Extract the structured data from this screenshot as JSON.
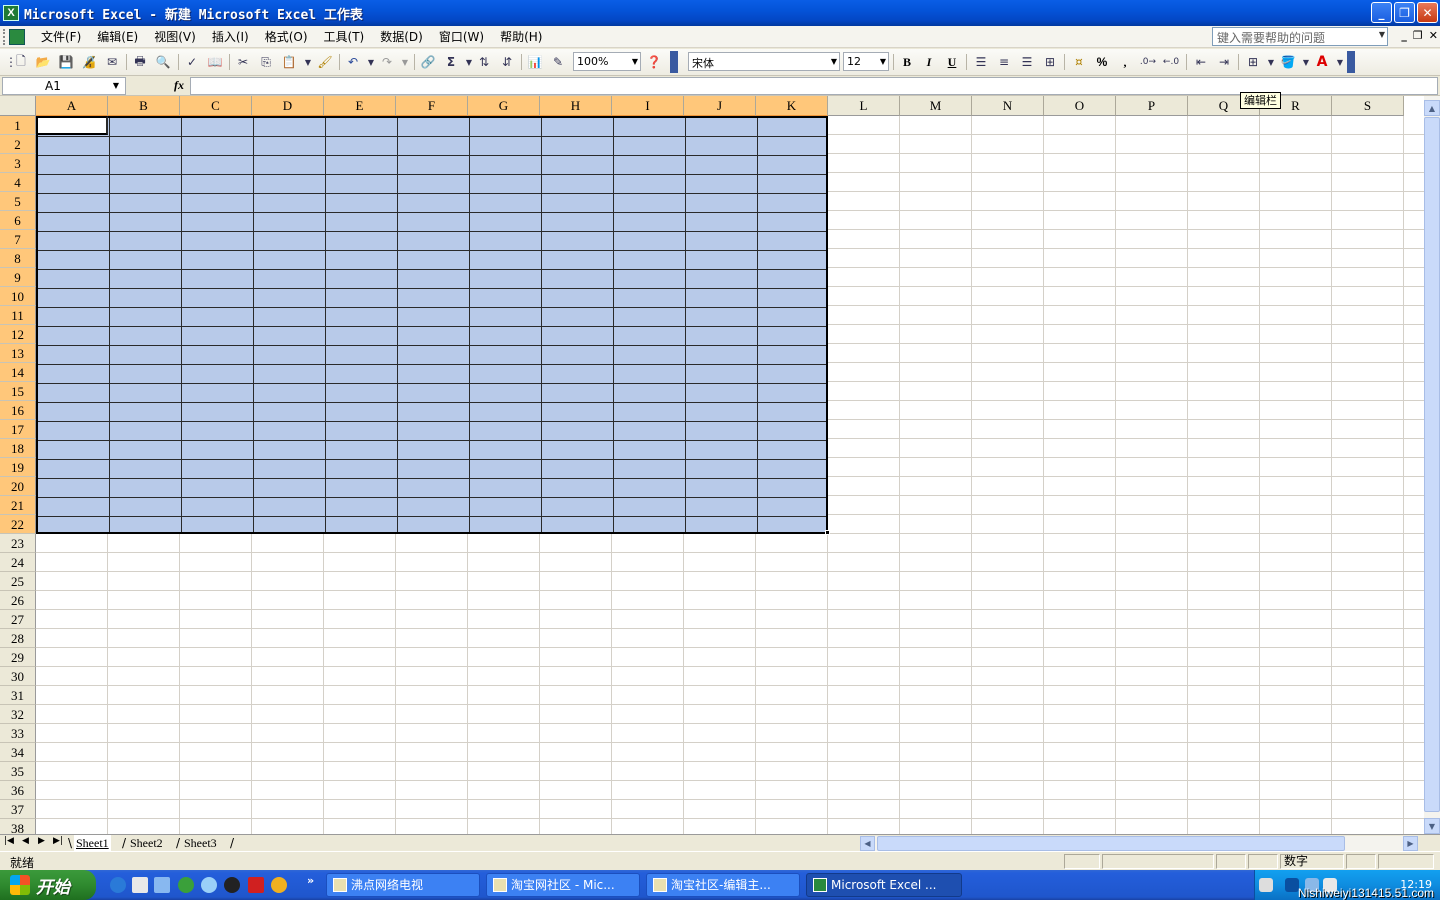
{
  "window": {
    "title": "Microsoft Excel - 新建 Microsoft Excel 工作表",
    "app_icon": "excel-icon"
  },
  "menu": {
    "items": [
      "文件(F)",
      "编辑(E)",
      "视图(V)",
      "插入(I)",
      "格式(O)",
      "工具(T)",
      "数据(D)",
      "窗口(W)",
      "帮助(H)"
    ],
    "help_placeholder": "键入需要帮助的问题"
  },
  "toolbar": {
    "zoom": "100%",
    "font_name": "宋体",
    "font_size": "12",
    "bold": "B",
    "italic": "I",
    "underline": "U",
    "percent": "%",
    "comma": ","
  },
  "formula_bar": {
    "name_box": "A1",
    "fx": "fx",
    "value": ""
  },
  "grid": {
    "columns": [
      "A",
      "B",
      "C",
      "D",
      "E",
      "F",
      "G",
      "H",
      "I",
      "J",
      "K",
      "L",
      "M",
      "N",
      "O",
      "P",
      "Q",
      "R",
      "S"
    ],
    "selected_columns": [
      "A",
      "B",
      "C",
      "D",
      "E",
      "F",
      "G",
      "H",
      "I",
      "J",
      "K"
    ],
    "rows": [
      "1",
      "2",
      "3",
      "4",
      "5",
      "6",
      "7",
      "8",
      "9",
      "10",
      "11",
      "12",
      "13",
      "14",
      "15",
      "16",
      "17",
      "18",
      "19",
      "20",
      "21",
      "22",
      "23",
      "24",
      "25",
      "26",
      "27",
      "28",
      "29",
      "30",
      "31",
      "32",
      "33",
      "34",
      "35",
      "36",
      "37",
      "38"
    ],
    "selected_rows_count": 22,
    "selection_range": "A1:K22",
    "selection_color": "#b8cae9",
    "header_highlight_color": "#ffc77a"
  },
  "tooltip": {
    "text": "编辑栏"
  },
  "sheets": {
    "tabs": [
      "Sheet1",
      "Sheet2",
      "Sheet3"
    ],
    "active": "Sheet1"
  },
  "status": {
    "left": "就绪",
    "num": "数字"
  },
  "taskbar": {
    "start": "开始",
    "tasks": [
      {
        "label": "沸点网络电视"
      },
      {
        "label": "淘宝网社区 - Mic..."
      },
      {
        "label": "淘宝社区-编辑主..."
      },
      {
        "label": "Microsoft Excel ..."
      }
    ],
    "clock": "12:19",
    "watermark": "Nishiweiyi131415.51.com"
  },
  "colors": {
    "title_bar": "#0453d8",
    "excel_green": "#1f7a35"
  }
}
